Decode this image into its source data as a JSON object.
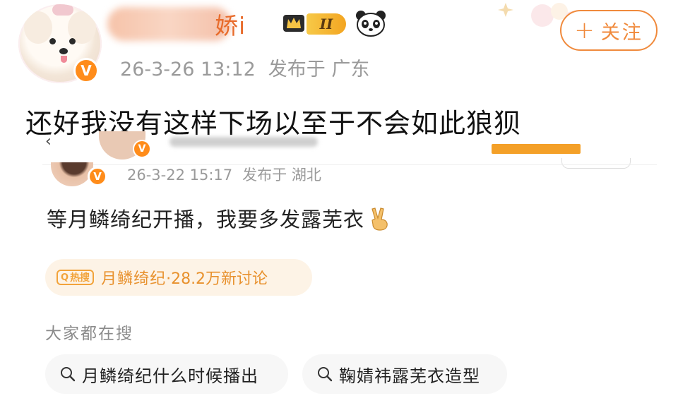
{
  "header": {
    "username_visible": "娇i",
    "rank_label": "II",
    "timestamp": "26-3-26 13:12",
    "location": "发布于 广东",
    "follow_label": "关注",
    "follow_plus": "+"
  },
  "caption": "还好我没有这样下场以至于不会如此狼狈",
  "quoted_post": {
    "timestamp": "26-3-22 15:17",
    "location": "发布于 湖北",
    "text": "等月鳞绮纪开播，我要多发露芜衣",
    "hot_search": {
      "badge": "热搜",
      "title": "月鳞绮纪",
      "count": "·28.2万新讨论"
    }
  },
  "everyone_searching": {
    "label": "大家都在搜",
    "items": [
      "月鳞绮纪什么时候播出",
      "鞠婧祎露芜衣造型"
    ]
  },
  "colors": {
    "accent": "#f08a3c",
    "username": "#e86c2c",
    "verified": "#ff8c1a",
    "hot_text": "#e8912d"
  },
  "icons": {
    "verified": "V",
    "victory": "victory-hand-icon",
    "search": "search-icon"
  }
}
